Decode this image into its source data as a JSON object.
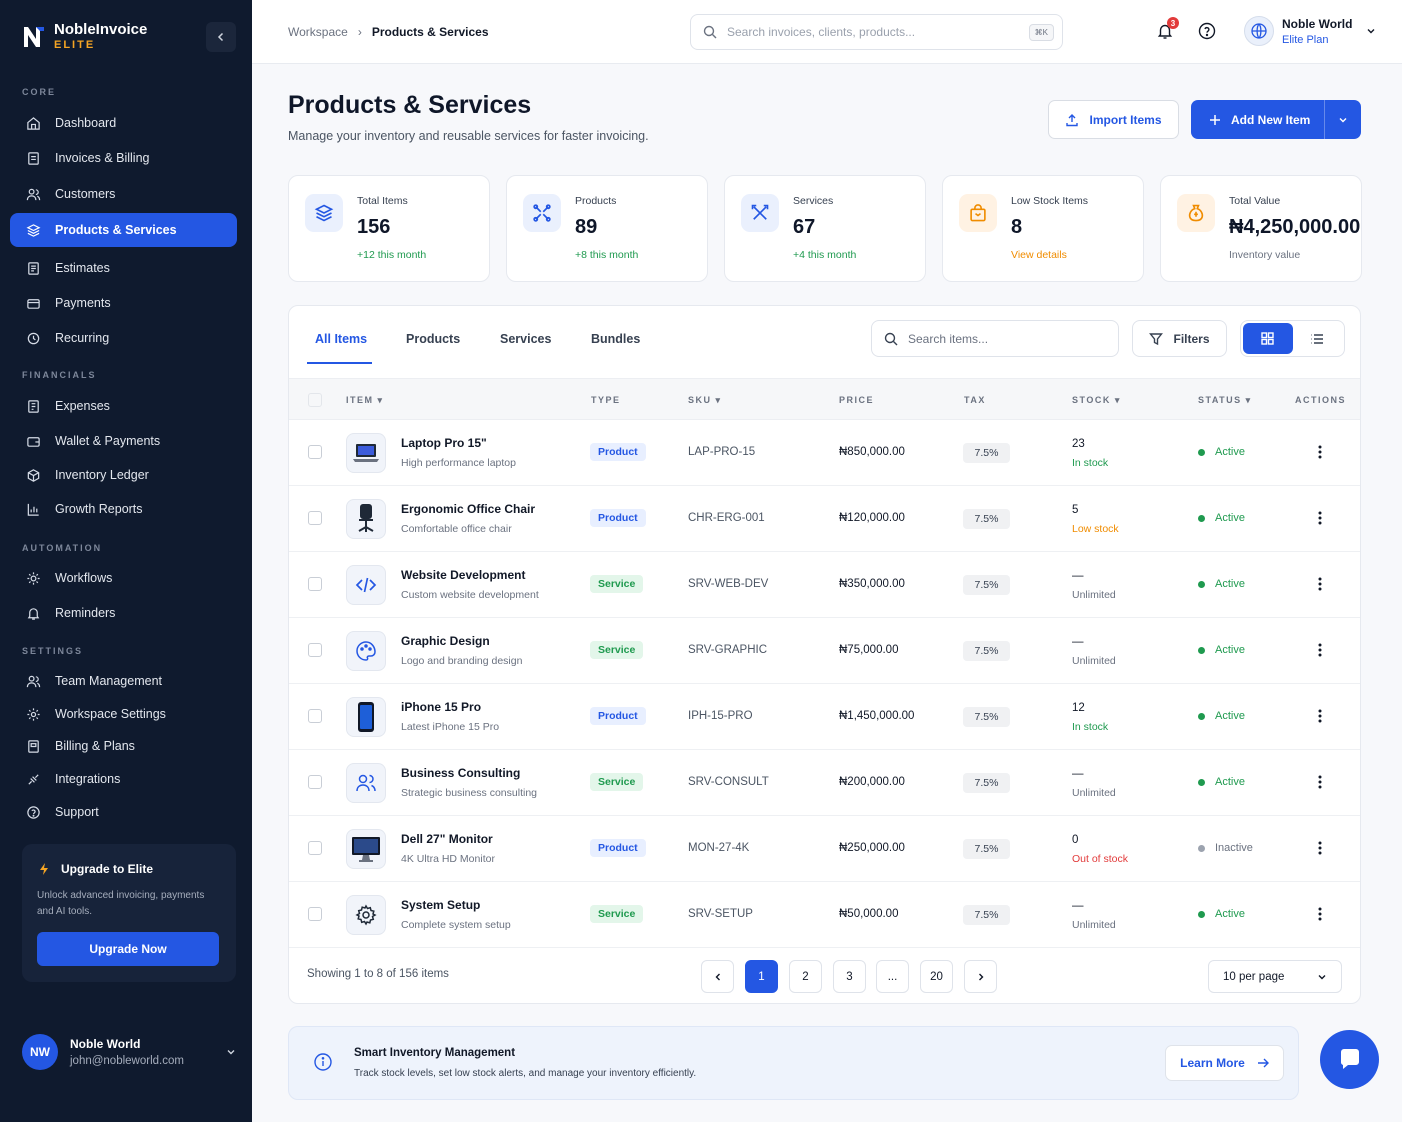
{
  "brand": {
    "name": "NobleInvoice",
    "tier": "ELITE"
  },
  "nav": {
    "sections": [
      "CORE",
      "FINANCIALS",
      "AUTOMATION",
      "SETTINGS"
    ],
    "core": [
      "Dashboard",
      "Invoices & Billing",
      "Customers",
      "Products & Services",
      "Estimates",
      "Payments",
      "Recurring"
    ],
    "financials": [
      "Expenses",
      "Wallet & Payments",
      "Inventory Ledger",
      "Growth Reports"
    ],
    "automation": [
      "Workflows",
      "Reminders"
    ],
    "settings": [
      "Team Management",
      "Workspace Settings",
      "Billing & Plans",
      "Integrations",
      "Support"
    ]
  },
  "upgrade": {
    "title": "Upgrade to Elite",
    "desc": "Unlock advanced invoicing, payments and AI tools.",
    "button": "Upgrade Now"
  },
  "sidebar_user": {
    "initials": "NW",
    "name": "Noble World",
    "email": "john@nobleworld.com"
  },
  "breadcrumb": {
    "root": "Workspace",
    "sep": "›",
    "current": "Products & Services"
  },
  "search": {
    "placeholder": "Search invoices, clients, products...",
    "shortcut": "⌘K"
  },
  "notifications": {
    "count": "3"
  },
  "top_user": {
    "name": "Noble World",
    "plan": "Elite Plan"
  },
  "page": {
    "title": "Products & Services",
    "subtitle": "Manage your inventory and reusable services for faster invoicing."
  },
  "actions": {
    "import": "Import Items",
    "add": "Add New Item"
  },
  "stats": [
    {
      "label": "Total Items",
      "value": "156",
      "sub": "+12 this month",
      "sub_color": "#1f9a4f",
      "icon": "layers-icon",
      "bg": "#eaf0fd",
      "fg": "#2457e3"
    },
    {
      "label": "Products",
      "value": "89",
      "sub": "+8 this month",
      "sub_color": "#1f9a4f",
      "icon": "box-icon",
      "bg": "#eaf0fd",
      "fg": "#2457e3"
    },
    {
      "label": "Services",
      "value": "67",
      "sub": "+4 this month",
      "sub_color": "#1f9a4f",
      "icon": "tools-icon",
      "bg": "#eaf0fd",
      "fg": "#2457e3"
    },
    {
      "label": "Low Stock Items",
      "value": "8",
      "sub": "View details",
      "sub_color": "#f08c00",
      "icon": "bag-icon",
      "bg": "#fff2e3",
      "fg": "#f08c00"
    },
    {
      "label": "Total Value",
      "value": "₦4,250,000.00",
      "sub": "Inventory value",
      "sub_color": "#6b7280",
      "icon": "money-bag-icon",
      "bg": "#fff2e3",
      "fg": "#f08c00"
    }
  ],
  "tabs": [
    "All Items",
    "Products",
    "Services",
    "Bundles"
  ],
  "item_search": {
    "placeholder": "Search items..."
  },
  "filters_label": "Filters",
  "columns": {
    "item": "ITEM",
    "type": "TYPE",
    "sku": "SKU",
    "price": "PRICE",
    "tax": "TAX",
    "stock": "STOCK",
    "status": "STATUS",
    "actions": "ACTIONS"
  },
  "items": [
    {
      "name": "Laptop Pro 15\"",
      "desc": "High performance laptop",
      "type": "Product",
      "sku": "LAP-PRO-15",
      "price": "₦850,000.00",
      "tax": "7.5%",
      "stock": "23",
      "stock_status": "In stock",
      "stock_color": "#1f9a4f",
      "status": "Active",
      "thumb": "laptop-icon"
    },
    {
      "name": "Ergonomic Office Chair",
      "desc": "Comfortable office chair",
      "type": "Product",
      "sku": "CHR-ERG-001",
      "price": "₦120,000.00",
      "tax": "7.5%",
      "stock": "5",
      "stock_status": "Low stock",
      "stock_color": "#f08c00",
      "status": "Active",
      "thumb": "chair-icon"
    },
    {
      "name": "Website Development",
      "desc": "Custom website development",
      "type": "Service",
      "sku": "SRV-WEB-DEV",
      "price": "₦350,000.00",
      "tax": "7.5%",
      "stock": "—",
      "stock_status": "Unlimited",
      "stock_color": "#6b7280",
      "status": "Active",
      "thumb": "code-icon"
    },
    {
      "name": "Graphic Design",
      "desc": "Logo and branding design",
      "type": "Service",
      "sku": "SRV-GRAPHIC",
      "price": "₦75,000.00",
      "tax": "7.5%",
      "stock": "—",
      "stock_status": "Unlimited",
      "stock_color": "#6b7280",
      "status": "Active",
      "thumb": "palette-icon"
    },
    {
      "name": "iPhone 15 Pro",
      "desc": "Latest iPhone 15 Pro",
      "type": "Product",
      "sku": "IPH-15-PRO",
      "price": "₦1,450,000.00",
      "tax": "7.5%",
      "stock": "12",
      "stock_status": "In stock",
      "stock_color": "#1f9a4f",
      "status": "Active",
      "thumb": "phone-icon"
    },
    {
      "name": "Business Consulting",
      "desc": "Strategic business consulting",
      "type": "Service",
      "sku": "SRV-CONSULT",
      "price": "₦200,000.00",
      "tax": "7.5%",
      "stock": "—",
      "stock_status": "Unlimited",
      "stock_color": "#6b7280",
      "status": "Active",
      "thumb": "users-icon"
    },
    {
      "name": "Dell 27\" Monitor",
      "desc": "4K Ultra HD Monitor",
      "type": "Product",
      "sku": "MON-27-4K",
      "price": "₦250,000.00",
      "tax": "7.5%",
      "stock": "0",
      "stock_status": "Out of stock",
      "stock_color": "#e23b3b",
      "status": "Inactive",
      "thumb": "monitor-icon"
    },
    {
      "name": "System Setup",
      "desc": "Complete system setup",
      "type": "Service",
      "sku": "SRV-SETUP",
      "price": "₦50,000.00",
      "tax": "7.5%",
      "stock": "—",
      "stock_status": "Unlimited",
      "stock_color": "#6b7280",
      "status": "Active",
      "thumb": "gear-icon"
    }
  ],
  "pagination": {
    "showing": "Showing 1 to 8 of 156 items",
    "pages": [
      "1",
      "2",
      "3",
      "...",
      "20"
    ],
    "current": "1",
    "per_page": "10 per page"
  },
  "smart": {
    "title": "Smart Inventory Management",
    "desc": "Track stock levels, set low stock alerts, and manage your inventory efficiently.",
    "link": "Learn More"
  }
}
